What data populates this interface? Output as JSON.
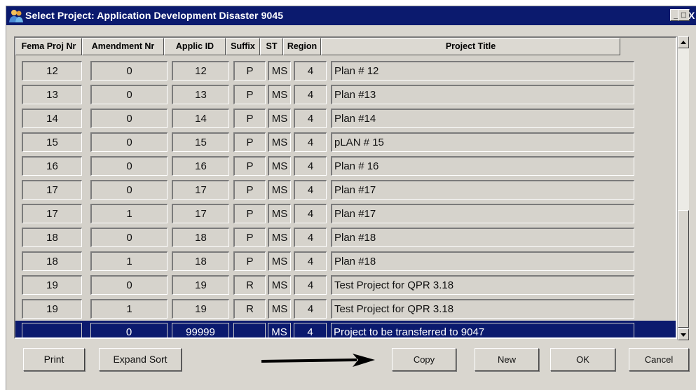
{
  "window": {
    "title": "Select Project: Application Development  Disaster 9045"
  },
  "titlebar_buttons": {
    "minimize": "_",
    "maximize": "□",
    "close": "X"
  },
  "columns": [
    {
      "key": "fema",
      "label": "Fema Proj Nr"
    },
    {
      "key": "amend",
      "label": "Amendment Nr"
    },
    {
      "key": "applic",
      "label": "Applic ID"
    },
    {
      "key": "suffix",
      "label": "Suffix"
    },
    {
      "key": "st",
      "label": "ST"
    },
    {
      "key": "region",
      "label": "Region"
    },
    {
      "key": "title",
      "label": "Project Title"
    }
  ],
  "rows": [
    {
      "fema": "12",
      "amend": "0",
      "applic": "12",
      "suffix": "P",
      "st": "MS",
      "region": "4",
      "title": "Plan # 12",
      "selected": false
    },
    {
      "fema": "13",
      "amend": "0",
      "applic": "13",
      "suffix": "P",
      "st": "MS",
      "region": "4",
      "title": "Plan #13",
      "selected": false
    },
    {
      "fema": "14",
      "amend": "0",
      "applic": "14",
      "suffix": "P",
      "st": "MS",
      "region": "4",
      "title": "Plan #14",
      "selected": false
    },
    {
      "fema": "15",
      "amend": "0",
      "applic": "15",
      "suffix": "P",
      "st": "MS",
      "region": "4",
      "title": "pLAN # 15",
      "selected": false
    },
    {
      "fema": "16",
      "amend": "0",
      "applic": "16",
      "suffix": "P",
      "st": "MS",
      "region": "4",
      "title": "Plan # 16",
      "selected": false
    },
    {
      "fema": "17",
      "amend": "0",
      "applic": "17",
      "suffix": "P",
      "st": "MS",
      "region": "4",
      "title": "Plan #17",
      "selected": false
    },
    {
      "fema": "17",
      "amend": "1",
      "applic": "17",
      "suffix": "P",
      "st": "MS",
      "region": "4",
      "title": "Plan #17",
      "selected": false
    },
    {
      "fema": "18",
      "amend": "0",
      "applic": "18",
      "suffix": "P",
      "st": "MS",
      "region": "4",
      "title": "Plan #18",
      "selected": false
    },
    {
      "fema": "18",
      "amend": "1",
      "applic": "18",
      "suffix": "P",
      "st": "MS",
      "region": "4",
      "title": "Plan #18",
      "selected": false
    },
    {
      "fema": "19",
      "amend": "0",
      "applic": "19",
      "suffix": "R",
      "st": "MS",
      "region": "4",
      "title": "Test Project for QPR 3.18",
      "selected": false
    },
    {
      "fema": "19",
      "amend": "1",
      "applic": "19",
      "suffix": "R",
      "st": "MS",
      "region": "4",
      "title": "Test Project for QPR 3.18",
      "selected": false
    },
    {
      "fema": "",
      "amend": "0",
      "applic": "99999",
      "suffix": "",
      "st": "MS",
      "region": "4",
      "title": "Project to be transferred to 9047",
      "selected": true
    }
  ],
  "buttons": {
    "print": "Print",
    "expand_sort": "Expand Sort",
    "copy": "Copy",
    "new": "New",
    "ok": "OK",
    "cancel": "Cancel"
  },
  "colors": {
    "title_bar": "#0b1a6e",
    "selection": "#0b1a6e",
    "dialog_bg": "#d9d6cf"
  },
  "icons": {
    "window": "people-icon",
    "annotation": "right-arrow-icon"
  }
}
